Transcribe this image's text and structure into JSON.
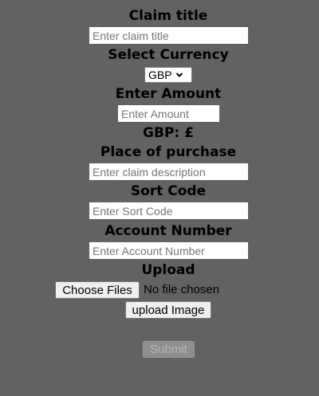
{
  "form": {
    "claim_title_label": "Claim title",
    "claim_title_placeholder": "Enter claim title",
    "currency_label": "Select Currency",
    "currency_selected": "GBP",
    "amount_label": "Enter Amount",
    "amount_placeholder": "Enter Amount",
    "currency_symbol_text": "GBP: £",
    "place_label": "Place of purchase",
    "place_placeholder": "Enter claim description",
    "sort_code_label": "Sort Code",
    "sort_code_placeholder": "Enter Sort Code",
    "account_label": "Account Number",
    "account_placeholder": "Enter Account Number",
    "upload_label": "Upload",
    "choose_files_label": "Choose Files",
    "no_file_text": "No file chosen",
    "upload_image_label": "upload Image",
    "submit_label": "Submit"
  },
  "icons": {
    "currency_dropdown": "chevron-down-icon"
  },
  "colors": {
    "background": "#626262",
    "input_background": "#ffffff",
    "button_background": "#efefef",
    "disabled_button_background": "#8e8e8e"
  }
}
